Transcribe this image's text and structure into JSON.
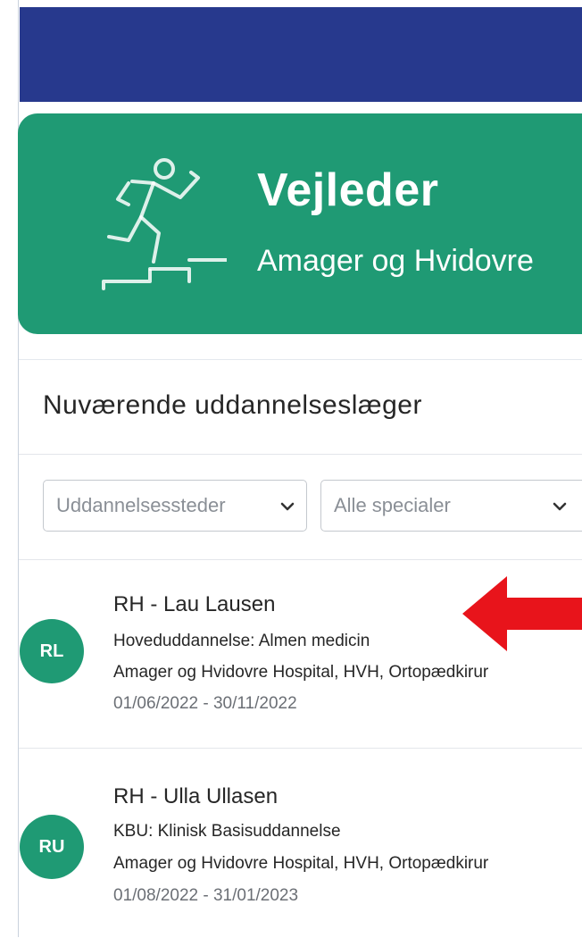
{
  "hero": {
    "title": "Vejleder",
    "subtitle": "Amager og Hvidovre",
    "icon": "running-up-stairs-icon",
    "color": "#1f9a74"
  },
  "topbar": {
    "color": "#27398d"
  },
  "panel": {
    "title": "Nuværende uddannelseslæger",
    "filters": [
      {
        "value": "Uddannelsessteder"
      },
      {
        "value": "Alle specialer"
      }
    ],
    "trainees": [
      {
        "initials": "RL",
        "name": "RH - Lau Lausen",
        "program": "Hoveduddannelse: Almen medicin",
        "location": "Amager og Hvidovre Hospital, HVH, Ortopædkirur",
        "period": "01/06/2022 - 30/11/2022"
      },
      {
        "initials": "RU",
        "name": "RH - Ulla Ullasen",
        "program": "KBU: Klinisk Basisuddannelse",
        "location": "Amager og Hvidovre Hospital, HVH, Ortopædkirur",
        "period": "01/08/2022 - 31/01/2023"
      }
    ]
  },
  "annotation": {
    "icon": "red-arrow-left-icon",
    "color": "#e8141b"
  }
}
